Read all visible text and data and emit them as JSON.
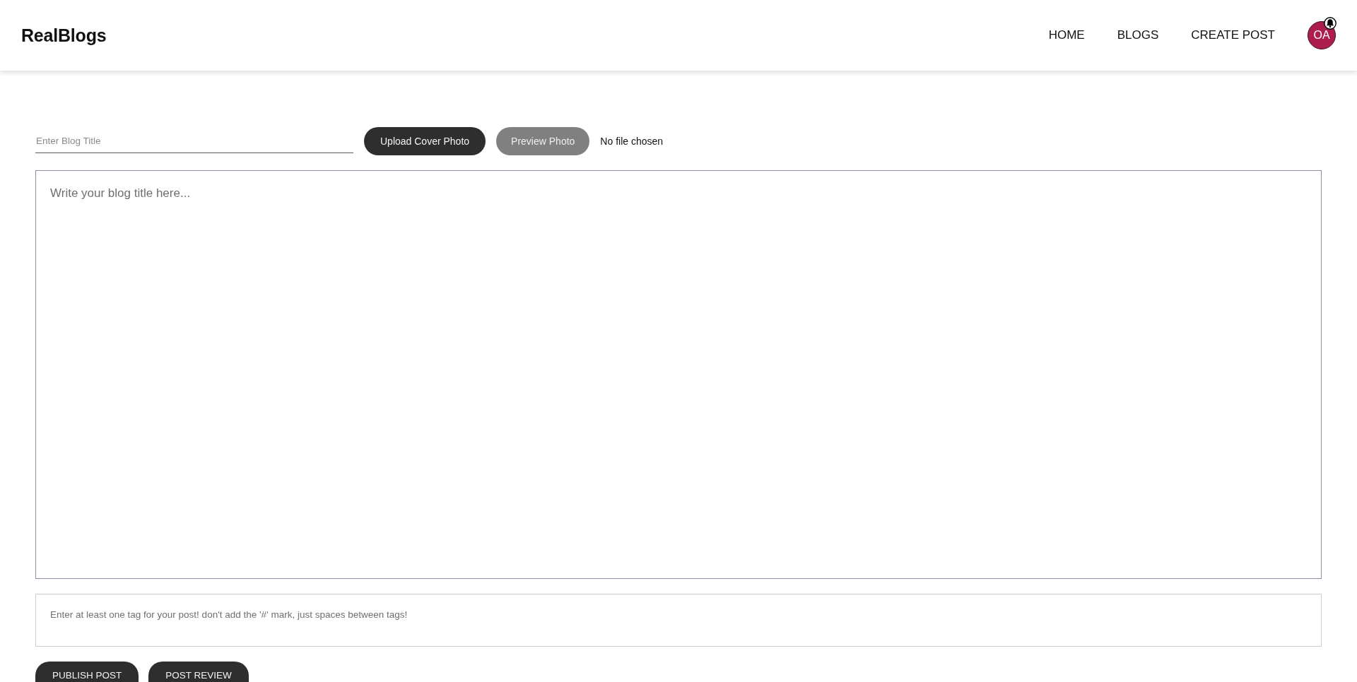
{
  "header": {
    "logo": "RealBlogs",
    "nav": [
      {
        "label": "HOME"
      },
      {
        "label": "BLOGS"
      },
      {
        "label": "CREATE POST"
      }
    ],
    "avatar": {
      "initials": "OA"
    }
  },
  "form": {
    "title_field": {
      "placeholder": "Enter Blog Title"
    },
    "photo_buttons": [
      {
        "label": "Upload Cover Photo",
        "disabled": false
      },
      {
        "label": "Preview Photo",
        "disabled": true
      }
    ],
    "file_status": "No file chosen",
    "body_field": {
      "placeholder": "Write your blog title here..."
    },
    "tags_field": {
      "placeholder": "Enter at least one tag for your post! don't add the '#' mark, just spaces between tags!"
    },
    "actions": [
      {
        "label": "PUBLISH POST"
      },
      {
        "label": "POST REVIEW"
      }
    ]
  }
}
